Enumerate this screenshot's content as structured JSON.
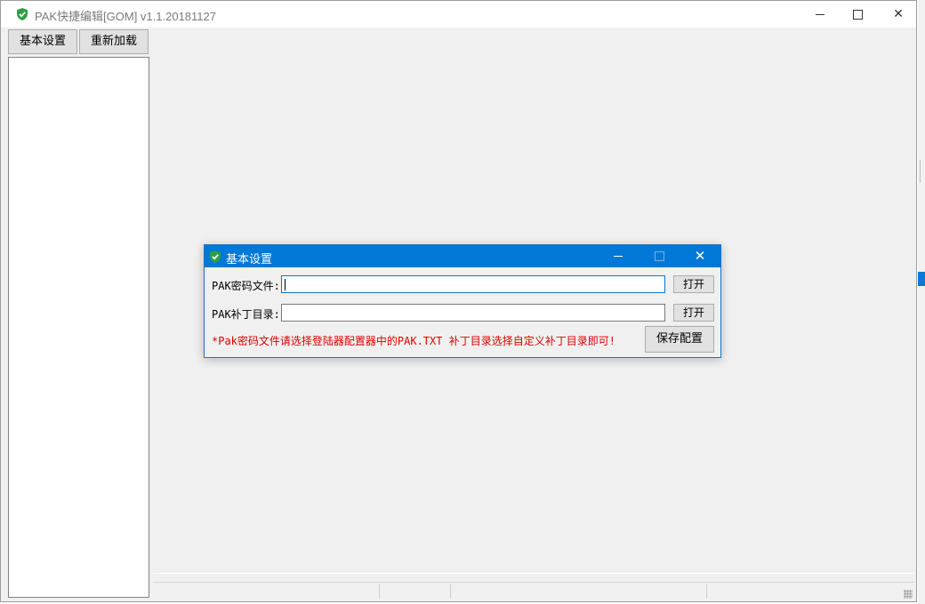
{
  "window": {
    "title": "PAK快捷编辑[GOM] v1.1.20181127"
  },
  "toolbar": {
    "basic_settings_label": "基本设置",
    "reload_label": "重新加载"
  },
  "dialog": {
    "title": "基本设置",
    "pak_key_file_label": "PAK密码文件:",
    "pak_key_file_value": "",
    "pak_patch_dir_label": "PAK补丁目录:",
    "pak_patch_dir_value": "",
    "open_label": "打开",
    "save_config_label": "保存配置",
    "note": "*Pak密码文件请选择登陆器配置器中的PAK.TXT 补丁目录选择自定义补丁目录即可!"
  },
  "colors": {
    "dialog_titlebar": "#0078d7",
    "note_text": "#e00000",
    "shield_icon": "#2ea043"
  }
}
